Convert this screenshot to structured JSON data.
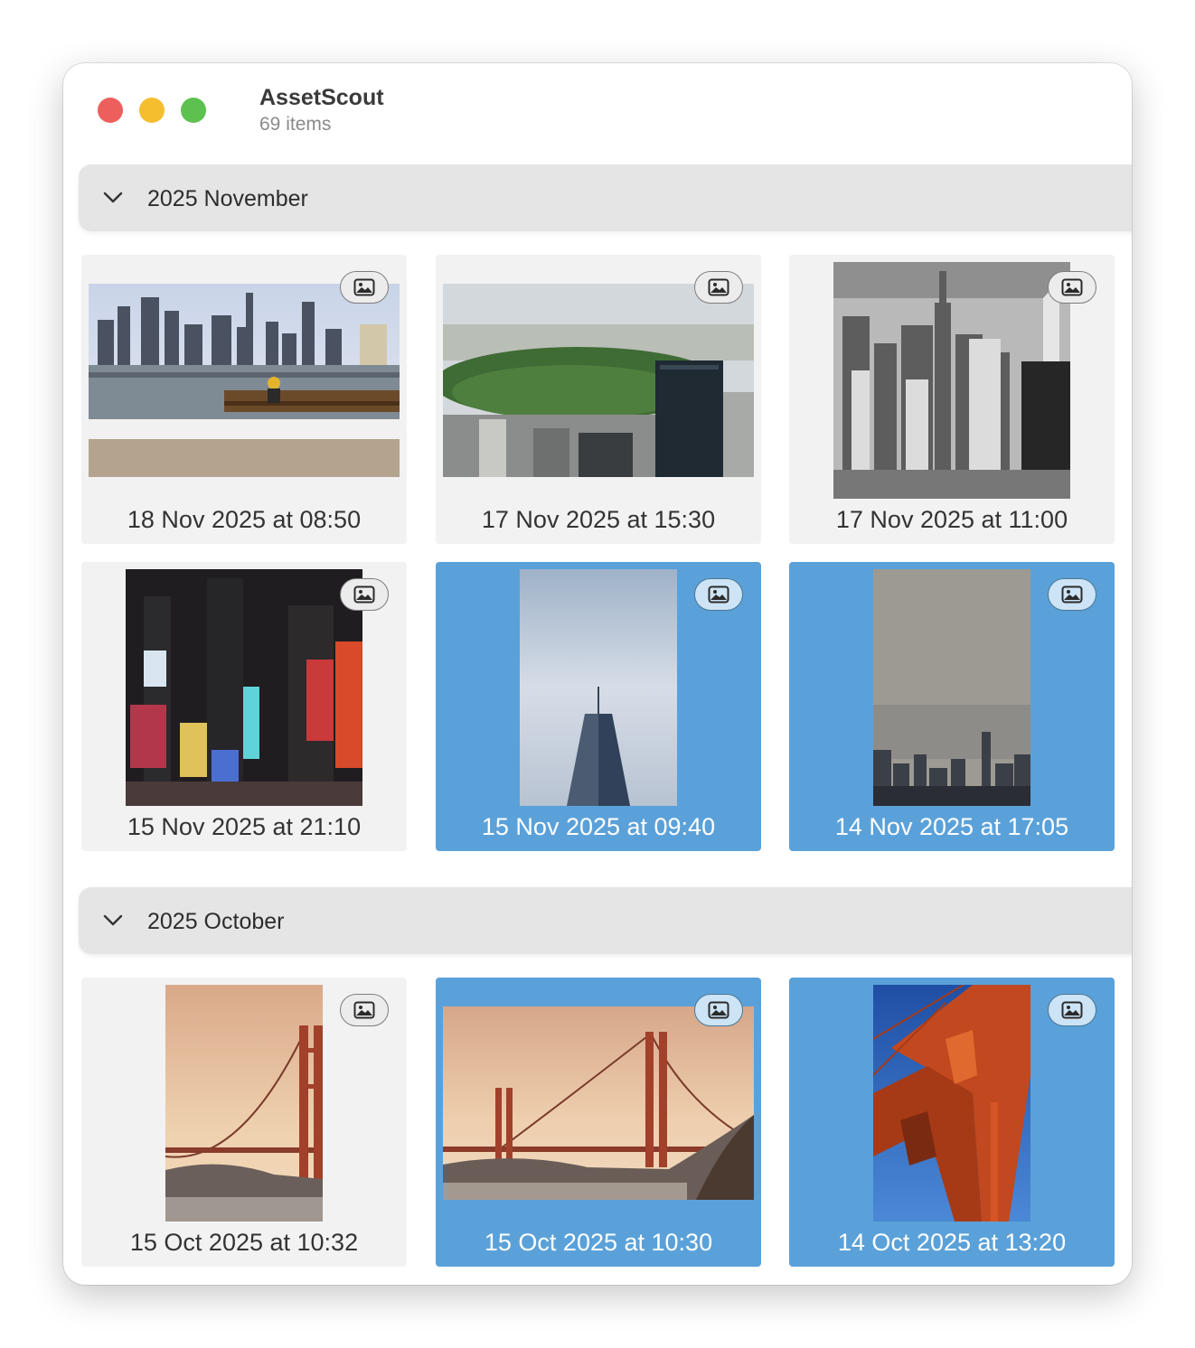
{
  "window": {
    "title": "AssetScout",
    "subtitle": "69 items"
  },
  "icons": {
    "section_toggle": "chevron-down-icon",
    "asset_type": "photo-icon"
  },
  "colors": {
    "selection": "#5ba1d9",
    "card_background": "#f2f2f2",
    "header_background": "#e5e5e5"
  },
  "sections": [
    {
      "title": "2025 November",
      "items": [
        {
          "label": "18 Nov 2025 at 08:50",
          "selected": false
        },
        {
          "label": "17 Nov 2025 at 15:30",
          "selected": false
        },
        {
          "label": "17 Nov 2025 at 11:00",
          "selected": false
        },
        {
          "label": "15 Nov 2025 at 21:10",
          "selected": false
        },
        {
          "label": "15 Nov 2025 at 09:40",
          "selected": true
        },
        {
          "label": "14 Nov 2025 at 17:05",
          "selected": true
        }
      ]
    },
    {
      "title": "2025 October",
      "items": [
        {
          "label": "15 Oct 2025 at 10:32",
          "selected": false
        },
        {
          "label": "15 Oct 2025 at 10:30",
          "selected": true
        },
        {
          "label": "14 Oct 2025 at 13:20",
          "selected": true
        }
      ]
    }
  ]
}
